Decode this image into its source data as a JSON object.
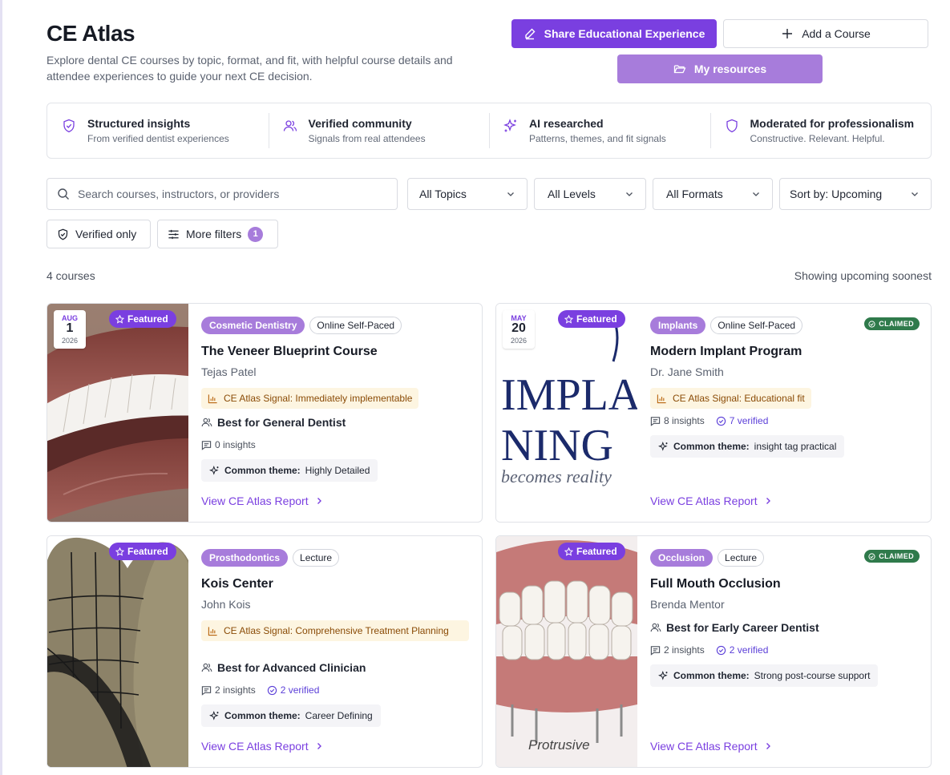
{
  "app": {
    "title": "CE Atlas",
    "subtitle": "Explore dental CE courses by topic, format, and fit, with helpful course details and attendee experiences to guide your next CE decision."
  },
  "actions": {
    "share_label": "Share Educational Experience",
    "add_label": "Add a Course",
    "resources_label": "My resources"
  },
  "features": [
    {
      "title": "Structured insights",
      "subtitle": "From verified dentist experiences",
      "icon": "shield-check-icon"
    },
    {
      "title": "Verified community",
      "subtitle": "Signals from real attendees",
      "icon": "users-icon"
    },
    {
      "title": "AI researched",
      "subtitle": "Patterns, themes, and fit signals",
      "icon": "sparkles-icon"
    },
    {
      "title": "Moderated for professionalism",
      "subtitle": "Constructive. Relevant. Helpful.",
      "icon": "shield-icon"
    }
  ],
  "filters": {
    "search_placeholder": "Search courses, instructors, or providers",
    "topic": "All Topics",
    "level": "All Levels",
    "format": "All Formats",
    "sort": "Sort by: Upcoming",
    "verified_only": "Verified only",
    "more_filters": "More filters",
    "more_filters_count": "1"
  },
  "results": {
    "count_label": "4 courses",
    "sort_note": "Showing upcoming soonest"
  },
  "common": {
    "featured": "Featured",
    "claimed": "CLAIMED",
    "report_link": "View CE Atlas Report",
    "theme_prefix": "Common theme:"
  },
  "courses": [
    {
      "topic": "Cosmetic Dentistry",
      "format": "Online Self-Paced",
      "title": "The Veneer Blueprint Course",
      "author": "Tejas Patel",
      "date": {
        "month": "AUG",
        "day": "1",
        "year": "2026"
      },
      "signal": "CE Atlas Signal: Immediately implementable",
      "best_for": "Best for General Dentist",
      "insights": "0 insights",
      "verified": "",
      "theme": "Highly Detailed",
      "claimed": false
    },
    {
      "topic": "Implants",
      "format": "Online Self-Paced",
      "title": "Modern Implant Program",
      "author": "Dr. Jane Smith",
      "date": {
        "month": "MAY",
        "day": "20",
        "year": "2026"
      },
      "signal": "CE Atlas Signal: Educational fit",
      "best_for": "",
      "insights": "8 insights",
      "verified": "7 verified",
      "theme": "insight tag practical",
      "claimed": true,
      "image_text": {
        "line1": "IMPLA",
        "line2": "NING",
        "line3": "becomes reality"
      }
    },
    {
      "topic": "Prosthodontics",
      "format": "Lecture",
      "title": "Kois Center",
      "author": "John Kois",
      "signal": "CE Atlas Signal: Comprehensive Treatment Planning",
      "best_for": "Best for Advanced Clinician",
      "insights": "2 insights",
      "verified": "2 verified",
      "theme": "Career Defining",
      "claimed": false
    },
    {
      "topic": "Occlusion",
      "format": "Lecture",
      "title": "Full Mouth Occlusion",
      "author": "Brenda Mentor",
      "signal": "",
      "best_for": "Best for Early Career Dentist",
      "insights": "2 insights",
      "verified": "2 verified",
      "theme": "Strong post-course support",
      "claimed": true,
      "image_text": {
        "caption": "Protrusive"
      }
    }
  ],
  "colors": {
    "accent": "#7a3fe0",
    "accent_light": "#a77cdb",
    "claimed_green": "#2f7a4b",
    "signal_bg": "#fdf5e1",
    "signal_text": "#8a4b06"
  }
}
